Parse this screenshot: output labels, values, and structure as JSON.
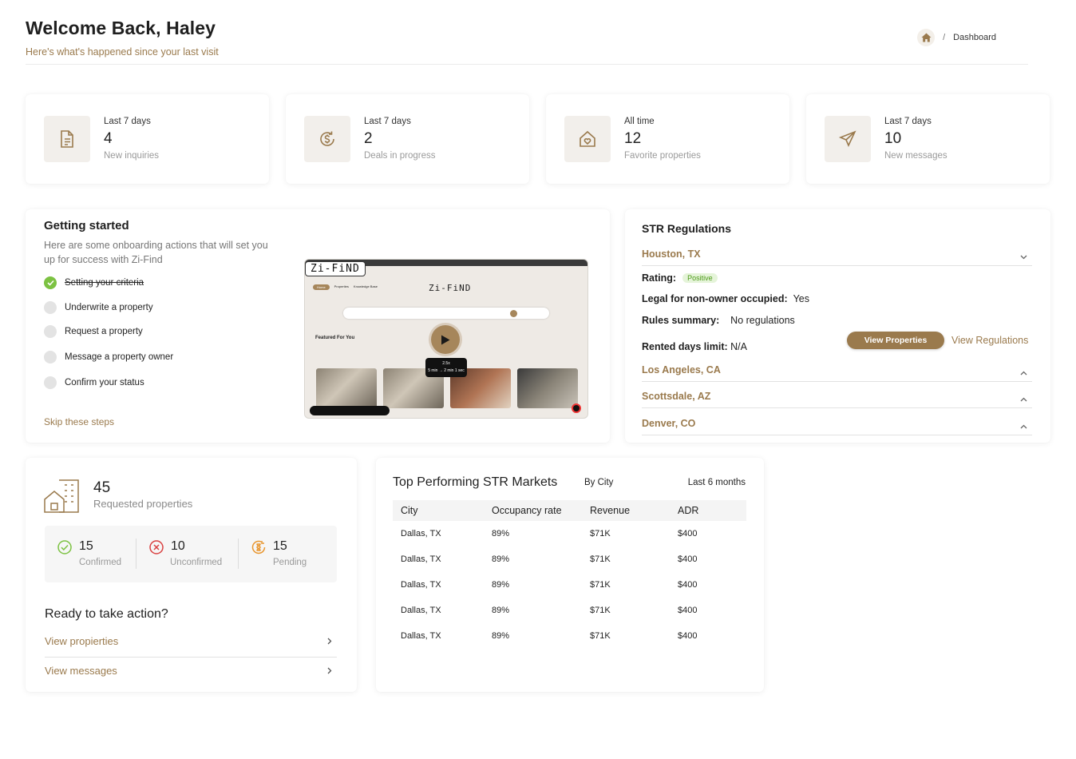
{
  "header": {
    "title": "Welcome Back, Haley",
    "subtitle": "Here's what's happened since your last visit",
    "breadcrumb": {
      "separator": "/",
      "current": "Dashboard"
    }
  },
  "stats": [
    {
      "period": "Last 7 days",
      "value": "4",
      "label": "New inquiries",
      "icon": "document-icon"
    },
    {
      "period": "Last 7 days",
      "value": "2",
      "label": "Deals in progress",
      "icon": "dollar-refresh-icon"
    },
    {
      "period": "All time",
      "value": "12",
      "label": "Favorite properties",
      "icon": "heart-house-icon"
    },
    {
      "period": "Last 7 days",
      "value": "10",
      "label": "New messages",
      "icon": "paper-plane-icon"
    }
  ],
  "getting_started": {
    "title": "Getting started",
    "description": "Here are some onboarding actions that will set you up for success with Zi-Find",
    "steps": [
      {
        "label": "Setting your criteria",
        "done": true
      },
      {
        "label": "Underwrite a property",
        "done": false
      },
      {
        "label": "Request a property",
        "done": false
      },
      {
        "label": "Message a property owner",
        "done": false
      },
      {
        "label": "Confirm your status",
        "done": false
      }
    ],
    "skip_label": "Skip these steps",
    "video": {
      "logo": "Zi-FiND",
      "app_title": "Zi-FiND",
      "nav": [
        "Home",
        "Properties",
        "Knowledge Base"
      ],
      "featured": "Featured For You",
      "speed": "2.5x",
      "tooltip": "5 min → 2 min 1 sec"
    }
  },
  "str_regulations": {
    "title": "STR Regulations",
    "cities": [
      {
        "name": "Houston, TX",
        "expanded": true
      },
      {
        "name": "Los Angeles, CA",
        "expanded": false
      },
      {
        "name": "Scottsdale, AZ",
        "expanded": false
      },
      {
        "name": "Denver, CO",
        "expanded": false
      }
    ],
    "details": {
      "rating_label": "Rating:",
      "rating_value": "Positive",
      "legal_label": "Legal for non-owner occupied:",
      "legal_value": "Yes",
      "rules_label": "Rules summary:",
      "rules_value": "No regulations",
      "rented_label": "Rented days limit:",
      "rented_value": "N/A"
    },
    "view_properties": "View Properties",
    "view_regulations": "View Regulations"
  },
  "requested": {
    "value": "45",
    "label": "Requested properties",
    "counts": [
      {
        "value": "15",
        "label": "Confirmed",
        "color": "#7cc242"
      },
      {
        "value": "10",
        "label": "Unconfirmed",
        "color": "#d94141"
      },
      {
        "value": "15",
        "label": "Pending",
        "color": "#e8962f"
      }
    ],
    "action_title": "Ready to take action?",
    "links": [
      "View propierties",
      "View messages"
    ]
  },
  "markets": {
    "title": "Top Performing STR Markets",
    "filter": "By City",
    "period": "Last 6 months",
    "columns": [
      "City",
      "Occupancy rate",
      "Revenue",
      "ADR"
    ],
    "rows": [
      [
        "Dallas, TX",
        "89%",
        "$71K",
        "$400"
      ],
      [
        "Dallas, TX",
        "89%",
        "$71K",
        "$400"
      ],
      [
        "Dallas, TX",
        "89%",
        "$71K",
        "$400"
      ],
      [
        "Dallas, TX",
        "89%",
        "$71K",
        "$400"
      ],
      [
        "Dallas, TX",
        "89%",
        "$71K",
        "$400"
      ]
    ]
  },
  "colors": {
    "accent": "#9a7a4d",
    "success": "#7cc242",
    "danger": "#d94141",
    "pending": "#e8962f"
  }
}
